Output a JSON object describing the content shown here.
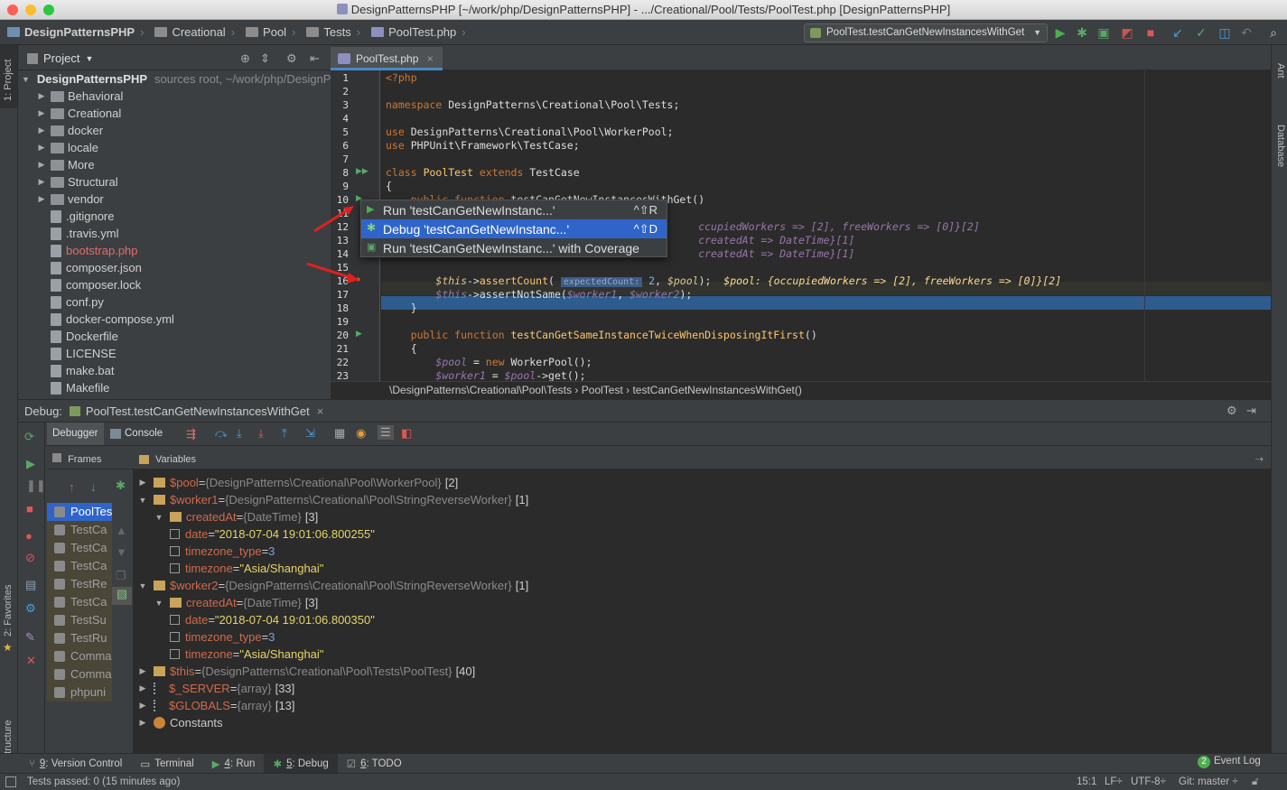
{
  "window": {
    "title": "DesignPatternsPHP [~/work/php/DesignPatternsPHP] - .../Creational/Pool/Tests/PoolTest.php [DesignPatternsPHP]"
  },
  "breadcrumbs": [
    "DesignPatternsPHP",
    "Creational",
    "Pool",
    "Tests",
    "PoolTest.php"
  ],
  "run_config": "PoolTest.testCanGetNewInstancesWithGet",
  "side_tabs": {
    "project": "1: Project",
    "favorites": "2: Favorites",
    "structure": "Z: Structure",
    "ant": "Ant",
    "database": "Database"
  },
  "project_panel": {
    "title": "Project",
    "tree": [
      {
        "label": "DesignPatternsPHP",
        "hint": "sources root,  ~/work/php/DesignPatternsPHP",
        "kind": "root"
      },
      {
        "label": "Behavioral",
        "kind": "folder"
      },
      {
        "label": "Creational",
        "kind": "folder"
      },
      {
        "label": "docker",
        "kind": "folder"
      },
      {
        "label": "locale",
        "kind": "folder"
      },
      {
        "label": "More",
        "kind": "folder"
      },
      {
        "label": "Structural",
        "kind": "folder"
      },
      {
        "label": "vendor",
        "kind": "folder"
      },
      {
        "label": ".gitignore",
        "kind": "file"
      },
      {
        "label": ".travis.yml",
        "kind": "file"
      },
      {
        "label": "bootstrap.php",
        "kind": "file-modified"
      },
      {
        "label": "composer.json",
        "kind": "file"
      },
      {
        "label": "composer.lock",
        "kind": "file"
      },
      {
        "label": "conf.py",
        "kind": "file"
      },
      {
        "label": "docker-compose.yml",
        "kind": "file"
      },
      {
        "label": "Dockerfile",
        "kind": "file"
      },
      {
        "label": "LICENSE",
        "kind": "file"
      },
      {
        "label": "make.bat",
        "kind": "file"
      },
      {
        "label": "Makefile",
        "kind": "file"
      }
    ]
  },
  "editor": {
    "tab": "PoolTest.php",
    "line_numbers": [
      "1",
      "2",
      "3",
      "4",
      "5",
      "6",
      "7",
      "8",
      "9",
      "10",
      "11",
      "12",
      "13",
      "14",
      "15",
      "16",
      "17",
      "18",
      "19",
      "20",
      "21",
      "22",
      "23"
    ],
    "breadcrumb": "\\DesignPatterns\\Creational\\Pool\\Tests  ›  PoolTest  ›  testCanGetNewInstancesWithGet()",
    "param_hint": "expectedCount:",
    "popup": [
      {
        "label": "Run 'testCanGetNewInstanc...'",
        "shortcut": "^⇧R"
      },
      {
        "label": "Debug 'testCanGetNewInstanc...'",
        "shortcut": "^⇧D"
      },
      {
        "label": "Run 'testCanGetNewInstanc...' with Coverage",
        "shortcut": ""
      }
    ]
  },
  "debug": {
    "label": "Debug:",
    "session": "PoolTest.testCanGetNewInstancesWithGet",
    "tabs": {
      "debugger": "Debugger",
      "console": "Console"
    },
    "frames_title": "Frames",
    "variables_title": "Variables",
    "frames": [
      "PoolTes",
      "TestCa",
      "TestCa",
      "TestCa",
      "TestRe",
      "TestCa",
      "TestSu",
      "TestRu",
      "Comma",
      "Comma",
      "phpuni"
    ]
  },
  "variables": [
    {
      "name": "$pool",
      "type": "{DesignPatterns\\Creational\\Pool\\WorkerPool}",
      "count": "[2]",
      "level": 0,
      "expanded": false
    },
    {
      "name": "$worker1",
      "type": "{DesignPatterns\\Creational\\Pool\\StringReverseWorker}",
      "count": "[1]",
      "level": 0,
      "expanded": true
    },
    {
      "name": "createdAt",
      "type": "{DateTime}",
      "count": "[3]",
      "level": 1,
      "expanded": true
    },
    {
      "name": "date",
      "value": "\"2018-07-04 19:01:06.800255\"",
      "level": 2
    },
    {
      "name": "timezone_type",
      "value": "3",
      "num": true,
      "level": 2
    },
    {
      "name": "timezone",
      "value": "\"Asia/Shanghai\"",
      "level": 2
    },
    {
      "name": "$worker2",
      "type": "{DesignPatterns\\Creational\\Pool\\StringReverseWorker}",
      "count": "[1]",
      "level": 0,
      "expanded": true
    },
    {
      "name": "createdAt",
      "type": "{DateTime}",
      "count": "[3]",
      "level": 1,
      "expanded": true
    },
    {
      "name": "date",
      "value": "\"2018-07-04 19:01:06.800350\"",
      "level": 2
    },
    {
      "name": "timezone_type",
      "value": "3",
      "num": true,
      "level": 2
    },
    {
      "name": "timezone",
      "value": "\"Asia/Shanghai\"",
      "level": 2
    },
    {
      "name": "$this",
      "type": "{DesignPatterns\\Creational\\Pool\\Tests\\PoolTest}",
      "count": "[40]",
      "level": 0,
      "expanded": false
    },
    {
      "name": "$_SERVER",
      "type": "{array}",
      "count": "[33]",
      "level": 0,
      "expanded": false
    },
    {
      "name": "$GLOBALS",
      "type": "{array}",
      "count": "[13]",
      "level": 0,
      "expanded": false
    },
    {
      "name": "Constants",
      "level": 0,
      "expanded": false,
      "plain": true
    }
  ],
  "bottom_tabs": [
    {
      "key": "9",
      "label": ": Version Control"
    },
    {
      "key": "",
      "label": "Terminal"
    },
    {
      "key": "4",
      "label": ": Run"
    },
    {
      "key": "5",
      "label": ": Debug"
    },
    {
      "key": "6",
      "label": ": TODO"
    }
  ],
  "event_log": {
    "count": "2",
    "label": "Event Log"
  },
  "status": {
    "message": "Tests passed: 0 (15 minutes ago)",
    "position": "15:1",
    "line_sep": "LF÷",
    "encoding": "UTF-8÷",
    "vcs": "Git: master ÷"
  },
  "colors": {
    "accent": "#2f65ca",
    "editor_bg": "#2b2b2b",
    "panel_bg": "#3c3f41",
    "keyword": "#cc7832",
    "variable": "#9876aa"
  }
}
